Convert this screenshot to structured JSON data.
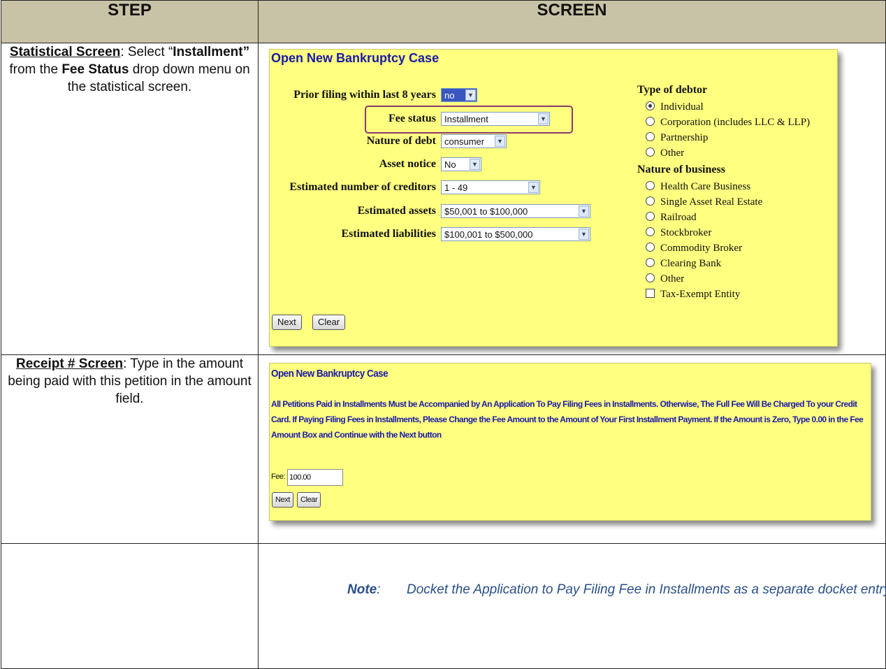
{
  "header": {
    "step": "STEP",
    "screen": "SCREEN"
  },
  "row1": {
    "step": {
      "title": "Statistical Screen",
      "p1": ": Select “",
      "b1": "Installment”",
      "p2": " from the ",
      "b2": "Fee Status",
      "p3": " drop down menu on the statistical screen."
    },
    "screen": {
      "title": "Open New Bankruptcy Case",
      "fields": [
        {
          "label": "Prior filing within last 8 years",
          "value": "no"
        },
        {
          "label": "Fee status",
          "value": "Installment"
        },
        {
          "label": "Nature of debt",
          "value": "consumer"
        },
        {
          "label": "Asset notice",
          "value": "No"
        },
        {
          "label": "Estimated number of creditors",
          "value": "1 - 49"
        },
        {
          "label": "Estimated assets",
          "value": "$50,001 to $100,000"
        },
        {
          "label": "Estimated liabilities",
          "value": "$100,001 to $500,000"
        }
      ],
      "debtor_heading": "Type of debtor",
      "debtor_options": [
        "Individual",
        "Corporation (includes LLC & LLP)",
        "Partnership",
        "Other"
      ],
      "debtor_selected": "Individual",
      "business_heading": "Nature of business",
      "business_options": [
        "Health Care Business",
        "Single Asset Real Estate",
        "Railroad",
        "Stockbroker",
        "Commodity Broker",
        "Clearing Bank",
        "Other"
      ],
      "tax_exempt": "Tax-Exempt Entity",
      "next": "Next",
      "clear": "Clear"
    }
  },
  "row2": {
    "step": {
      "title": "Receipt # Screen",
      "text": ": Type in the amount being paid with this petition in the amount field."
    },
    "screen": {
      "title": "Open New Bankruptcy Case",
      "notice": "All Petitions Paid in Installments Must be Accompanied by An Application To Pay Filing Fees in Installments. Otherwise, The Full Fee Will Be Charged To your Credit Card. If Paying Filing Fees in Installments, Please Change the Fee Amount to the Amount of Your First Installment Payment. If the Amount is Zero, Type 0.00 in the Fee Amount Box and Continue with the Next button",
      "fee_label": "Fee: $",
      "fee_value": "100.00",
      "next": "Next",
      "clear": "Clear"
    }
  },
  "row3": {
    "note_label": "Note",
    "note_colon": ":",
    "note_text": "Docket the Application to Pay Filing Fee in Installments as a separate docket entry."
  }
}
